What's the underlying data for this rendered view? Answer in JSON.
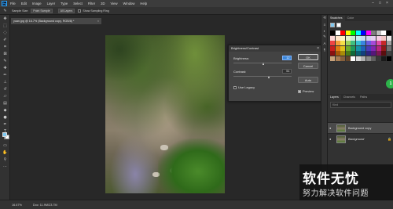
{
  "app": {
    "logo": "Ps"
  },
  "menu": [
    "File",
    "Edit",
    "Image",
    "Layer",
    "Type",
    "Select",
    "Filter",
    "3D",
    "View",
    "Window",
    "Help"
  ],
  "window_controls": [
    "–",
    "□",
    "×"
  ],
  "options_bar": {
    "sample_label": "Sample Size:",
    "sample_value": "Point Sample",
    "sample_chk": "All Layers",
    "show_ring": "Show Sampling Ring"
  },
  "document": {
    "tab_title": "yuan.jpg @ 16.7% (Background copy, RGB/8) *",
    "close": "×"
  },
  "dialog": {
    "title": "Brightness/Contrast",
    "close": "×",
    "brightness_label": "Brightness:",
    "brightness_value": "12",
    "brightness_level": 0.53,
    "contrast_label": "Contrast:",
    "contrast_value": "51",
    "contrast_level": 0.62,
    "use_legacy": "Use Legacy",
    "ok": "OK",
    "cancel": "Cancel",
    "auto": "Auto",
    "preview": "Preview",
    "preview_checked": true,
    "legacy_checked": false
  },
  "swatches_panel": {
    "tabs": [
      "Swatches",
      "Color"
    ],
    "colors": [
      "#000000",
      "#ffffff",
      "#ff0000",
      "#ffff00",
      "#00ff00",
      "#00ffff",
      "#0000ff",
      "#ff00ff",
      "#7f7f7f",
      "#bfbfbf",
      "#ffffff",
      "#000000",
      "#fbd5d5",
      "#fde4c8",
      "#fff6c4",
      "#e4f3c9",
      "#c9ecd6",
      "#c6ebef",
      "#c8dbf3",
      "#d3cff0",
      "#e6cff0",
      "#f6cde4",
      "#f2c6c6",
      "#e7e7e7",
      "#ef4444",
      "#f59e3a",
      "#f5e04a",
      "#9bd35a",
      "#3fbf7f",
      "#37c0d2",
      "#3a86e0",
      "#6a5be0",
      "#a64ad8",
      "#e04aa6",
      "#c62828",
      "#a0a0a0",
      "#c81e1e",
      "#e07a12",
      "#e0c21a",
      "#6fae2a",
      "#1f9a5a",
      "#1592a6",
      "#1e62b8",
      "#4a3cb8",
      "#8226b0",
      "#b82680",
      "#8e1a1a",
      "#707070",
      "#8a1010",
      "#a85608",
      "#a88c08",
      "#4a7a16",
      "#0f6a3a",
      "#0a6272",
      "#12407e",
      "#2e2480",
      "#56167a",
      "#7e1656",
      "#5a0e0e",
      "#404040",
      "#c9a27a",
      "#a87c52",
      "#86603c",
      "#644428",
      "#ffffff",
      "#d8d8d8",
      "#b0b0b0",
      "#888888",
      "#606060",
      "#383838",
      "#1a1a1a",
      "#000000"
    ]
  },
  "layers_panel": {
    "tabs": [
      "Layers",
      "Channels",
      "Paths"
    ],
    "search": "Kind",
    "layers": [
      {
        "name": "Background copy",
        "italic": false,
        "active": true
      },
      {
        "name": "Background",
        "italic": true,
        "active": false
      }
    ],
    "eye": "●",
    "lock": "🔒"
  },
  "status": {
    "zoom": "16.67%",
    "doc": "Doc: 11.9M/23.7M"
  },
  "watermark": {
    "logo": "软件无忧",
    "sub": "努力解决软件问题"
  },
  "green_bubble": "1"
}
